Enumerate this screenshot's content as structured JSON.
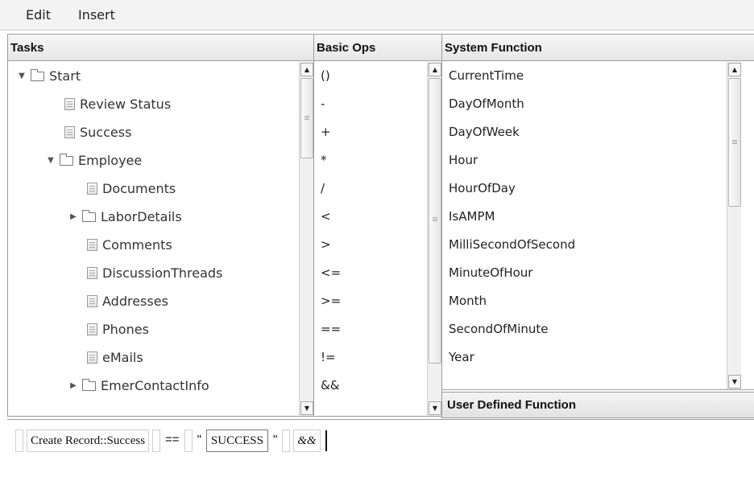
{
  "menubar": {
    "items": [
      "Edit",
      "Insert"
    ]
  },
  "tasks": {
    "header": "Tasks",
    "rows": [
      {
        "label": "Start",
        "kind": "folder-open",
        "expander": "▼"
      },
      {
        "label": "Review Status",
        "kind": "doc"
      },
      {
        "label": "Success",
        "kind": "doc"
      },
      {
        "label": "Employee",
        "kind": "folder-open",
        "expander": "▼"
      },
      {
        "label": "Documents",
        "kind": "doc"
      },
      {
        "label": "LaborDetails",
        "kind": "folder",
        "expander": "▶"
      },
      {
        "label": "Comments",
        "kind": "doc"
      },
      {
        "label": "DiscussionThreads",
        "kind": "doc"
      },
      {
        "label": "Addresses",
        "kind": "doc"
      },
      {
        "label": "Phones",
        "kind": "doc"
      },
      {
        "label": "eMails",
        "kind": "doc"
      },
      {
        "label": "EmerContactInfo",
        "kind": "folder",
        "expander": "▶"
      }
    ]
  },
  "basic_ops": {
    "header": "Basic Ops",
    "items": [
      "()",
      "-",
      "+",
      "*",
      "/",
      "<",
      ">",
      "<=",
      ">=",
      "==",
      "!=",
      "&&"
    ]
  },
  "system_function": {
    "header": "System Function",
    "items": [
      "CurrentTime",
      "DayOfMonth",
      "DayOfWeek",
      "Hour",
      "HourOfDay",
      "IsAMPM",
      "MilliSecondOfSecond",
      "MinuteOfHour",
      "Month",
      "SecondOfMinute",
      "Year"
    ]
  },
  "user_defined_function": {
    "header": "User Defined Function"
  },
  "expression": {
    "field": "Create Record::Success",
    "operator": "==",
    "quote_open": "\"",
    "string_value": "SUCCESS",
    "quote_close": "\"",
    "logic_op": "&&"
  },
  "icons": {
    "expanded": "triangle-down-icon",
    "collapsed": "triangle-right-icon",
    "folder": "folder-icon",
    "document": "document-icon",
    "scroll_up": "scroll-up-arrow-icon",
    "scroll_down": "scroll-down-arrow-icon"
  }
}
